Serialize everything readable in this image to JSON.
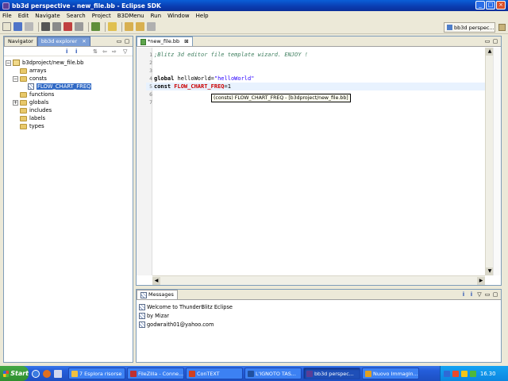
{
  "window": {
    "title": "bb3d perspective - new_file.bb - Eclipse SDK"
  },
  "menu": [
    "File",
    "Edit",
    "Navigate",
    "Search",
    "Project",
    "B3DMenu",
    "Run",
    "Window",
    "Help"
  ],
  "toolbar": {
    "perspective_label": "bb3d perspec..."
  },
  "left_panel": {
    "tabs": [
      {
        "label": "Navigator"
      },
      {
        "label": "bb3d explorer"
      }
    ],
    "tree": {
      "project": "b3dproject/new_file.bb",
      "items": [
        {
          "label": "arrays",
          "expandable": false
        },
        {
          "label": "consts",
          "expandable": true,
          "expanded": true
        },
        {
          "label": "FLOW_CHART_FREQ",
          "child": true,
          "selected": true
        },
        {
          "label": "functions",
          "expandable": false
        },
        {
          "label": "globals",
          "expandable": true,
          "expanded": false
        },
        {
          "label": "includes",
          "expandable": false
        },
        {
          "label": "labels",
          "expandable": false
        },
        {
          "label": "types",
          "expandable": false
        }
      ]
    }
  },
  "editor": {
    "tab_label": "*new_file.bb",
    "lines": [
      {
        "num": "1",
        "comment": ";Blitz 3d editor file template wizard. ENJOY !"
      },
      {
        "num": "2"
      },
      {
        "num": "3"
      },
      {
        "num": "4",
        "keyword": "global",
        "ident": " helloWorld=",
        "string": "\"helloWorld\""
      },
      {
        "num": "5",
        "keyword": "const",
        "name": " FLOW_CHART_FREQ",
        "rest": "=1"
      },
      {
        "num": "6"
      },
      {
        "num": "7"
      }
    ],
    "tooltip": "(consts) FLOW_CHART_FREQ - [b3dproject/new_file.bb]"
  },
  "messages": {
    "tab_label": "Messages",
    "items": [
      "Welcome to ThunderBlitz Eclipse",
      "by Mizar",
      "godwraith01@yahoo.com"
    ]
  },
  "taskbar": {
    "start_label": "Start",
    "tasks": [
      {
        "label": "7 Esplora risorse",
        "color": "#f0c040"
      },
      {
        "label": "FileZilla - Conne...",
        "color": "#c03030"
      },
      {
        "label": "ConTEXT",
        "color": "#d04020"
      },
      {
        "label": "L'IGNOTO TAS...",
        "color": "#2050a0"
      },
      {
        "label": "bb3d perspec...",
        "color": "#5a3e96"
      },
      {
        "label": "Nuovo Immagin...",
        "color": "#e0a020"
      }
    ],
    "clock": "16.30"
  }
}
